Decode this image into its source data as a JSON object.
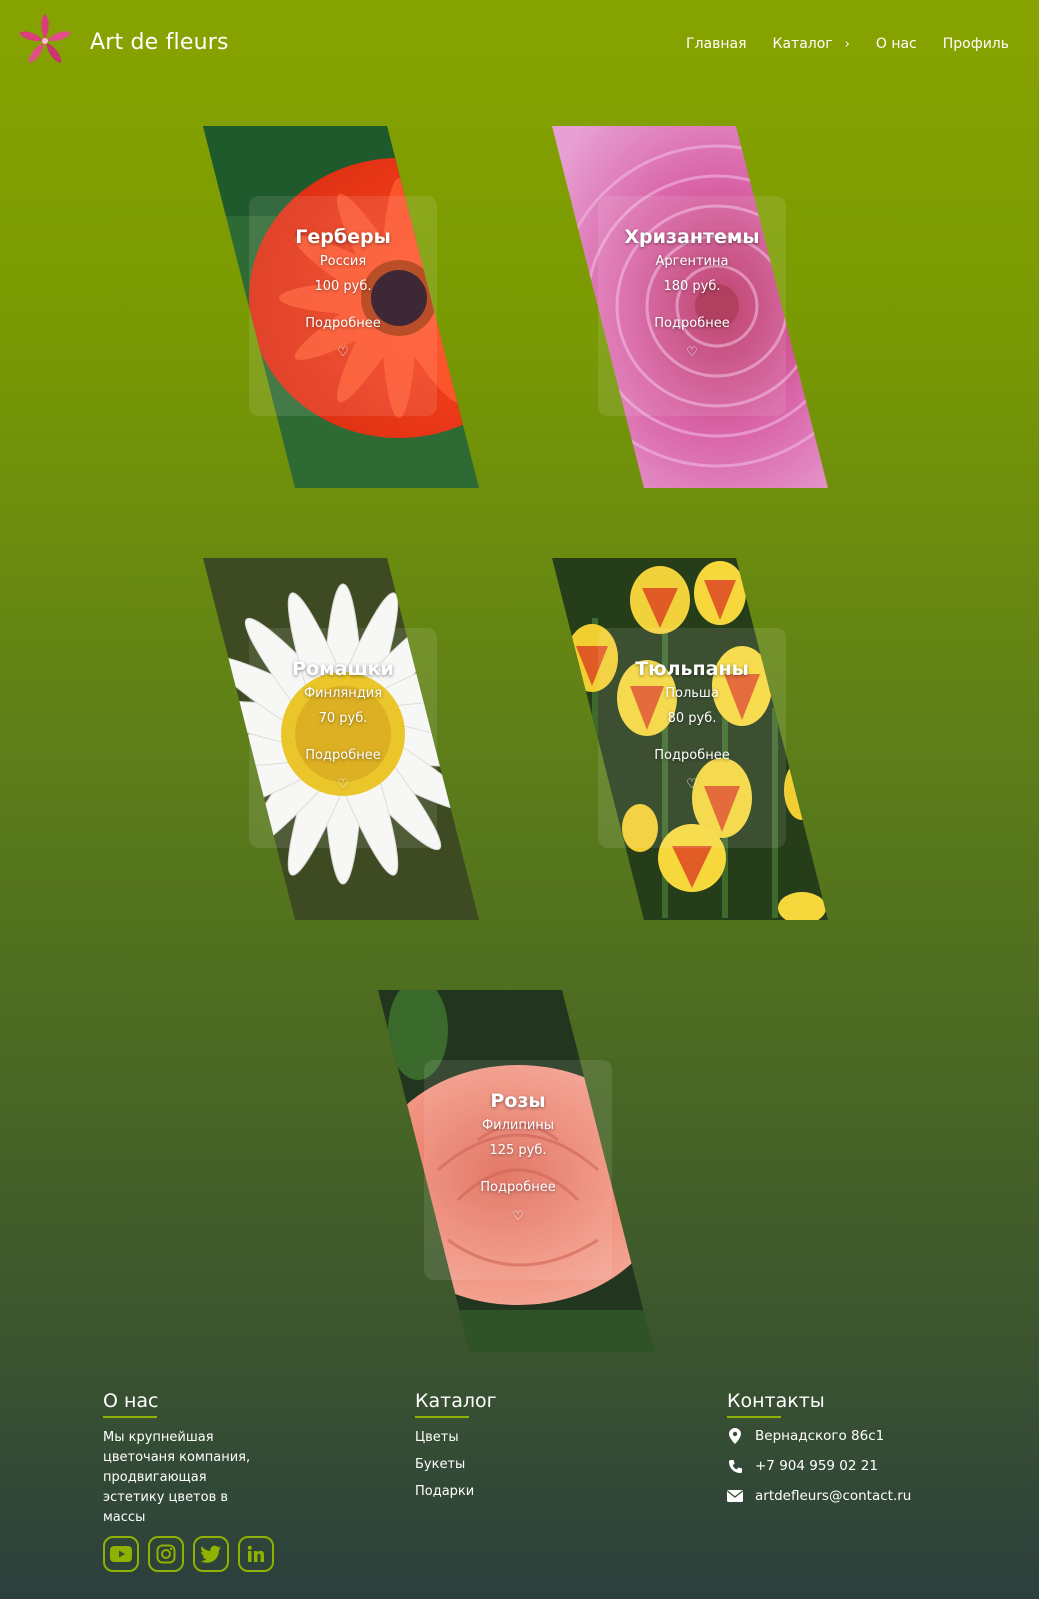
{
  "header": {
    "brand": "Art de fleurs",
    "nav": [
      {
        "label": "Главная"
      },
      {
        "label": "Каталог",
        "chevron": "›"
      },
      {
        "label": "О нас"
      },
      {
        "label": "Профиль"
      }
    ]
  },
  "cards": [
    {
      "title": "Герберы",
      "country": "Россия",
      "price": "100 руб.",
      "more": "Подробнее",
      "heart": "♡",
      "photo": "red-gerbera"
    },
    {
      "title": "Хризантемы",
      "country": "Аргентина",
      "price": "180 руб.",
      "more": "Подробнее",
      "heart": "♡",
      "photo": "pink-chrysanthemum"
    },
    {
      "title": "Ромашки",
      "country": "Финляндия",
      "price": "70 руб.",
      "more": "Подробнее",
      "heart": "♡",
      "photo": "white-daisy"
    },
    {
      "title": "Тюльпаны",
      "country": "Польша",
      "price": "80 руб.",
      "more": "Подробнее",
      "heart": "♡",
      "photo": "yellow-red-tulips"
    },
    {
      "title": "Розы",
      "country": "Филипины",
      "price": "125 руб.",
      "more": "Подробнее",
      "heart": "♡",
      "photo": "peach-rose"
    }
  ],
  "footer": {
    "about": {
      "heading": "О нас",
      "text": "Мы крупнейшая цветочаня компания, продвигающая эстетику цветов в массы"
    },
    "catalog": {
      "heading": "Каталог",
      "links": [
        "Цветы",
        "Букеты",
        "Подарки"
      ]
    },
    "contacts": {
      "heading": "Контакты",
      "address": "Вернадского 86с1",
      "phone": "+7 904 959 02 21",
      "email": "artdefleurs@contact.ru"
    },
    "socials": [
      "youtube-icon",
      "instagram-icon",
      "twitter-icon",
      "linkedin-icon"
    ]
  },
  "colors": {
    "accent": "#8fb100",
    "logo": "#d9407a"
  }
}
